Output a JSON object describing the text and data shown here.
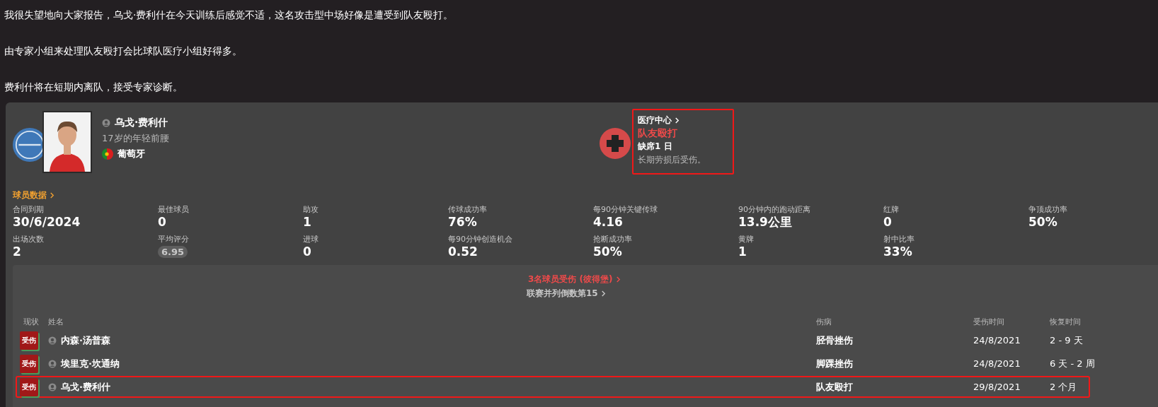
{
  "message": [
    "我很失望地向大家报告，乌戈·费利什在今天训练后感觉不适，这名攻击型中场好像是遭受到队友殴打。",
    "由专家小组来处理队友殴打会比球队医疗小组好得多。",
    "费利什将在短期内离队，接受专家诊断。"
  ],
  "player": {
    "name": "乌戈·费利什",
    "description": "17岁的年轻前腰",
    "nationality": "葡萄牙"
  },
  "medical": {
    "link": "医疗中心",
    "injury": "队友殴打",
    "absence": "缺席1 日",
    "note": "长期劳损后受伤。",
    "highlighted": true
  },
  "stats": {
    "link": "球员数据",
    "items": [
      {
        "label": "合同到期",
        "value": "30/6/2024",
        "kind": "plain"
      },
      {
        "label": "最佳球员",
        "value": "0",
        "kind": "plain"
      },
      {
        "label": "助攻",
        "value": "1",
        "kind": "plain"
      },
      {
        "label": "传球成功率",
        "value": "76%",
        "kind": "plain"
      },
      {
        "label": "每90分钟关键传球",
        "value": "4.16",
        "kind": "plain"
      },
      {
        "label": "90分钟内的跑动距离",
        "value": "13.9公里",
        "kind": "plain"
      },
      {
        "label": "红牌",
        "value": "0",
        "kind": "plain"
      },
      {
        "label": "争顶成功率",
        "value": "50%",
        "kind": "plain"
      },
      {
        "label": "出场次数",
        "value": "2",
        "kind": "plain"
      },
      {
        "label": "平均评分",
        "value": "6.95",
        "kind": "rating"
      },
      {
        "label": "进球",
        "value": "0",
        "kind": "plain"
      },
      {
        "label": "每90分钟创造机会",
        "value": "0.52",
        "kind": "plain"
      },
      {
        "label": "抢断成功率",
        "value": "50%",
        "kind": "plain"
      },
      {
        "label": "黄牌",
        "value": "1",
        "kind": "plain"
      },
      {
        "label": "射中比率",
        "value": "33%",
        "kind": "plain"
      }
    ]
  },
  "injuries": {
    "title": "3名球员受伤 (彼得堡)",
    "subtitle": "联赛并列倒数第15",
    "columns": [
      "现状",
      "姓名",
      "伤病",
      "受伤时间",
      "恢复时间"
    ],
    "rows": [
      {
        "status": "受伤",
        "name": "内森·汤普森",
        "injury": "胫骨挫伤",
        "date": "24/8/2021",
        "recovery": "2 - 9 天",
        "highlighted": false
      },
      {
        "status": "受伤",
        "name": "埃里克·坎通纳",
        "injury": "脚踝挫伤",
        "date": "24/8/2021",
        "recovery": "6 天 - 2 周",
        "highlighted": false
      },
      {
        "status": "受伤",
        "name": "乌戈·费利什",
        "injury": "队友殴打",
        "date": "29/8/2021",
        "recovery": "2 个月",
        "highlighted": true
      }
    ]
  }
}
